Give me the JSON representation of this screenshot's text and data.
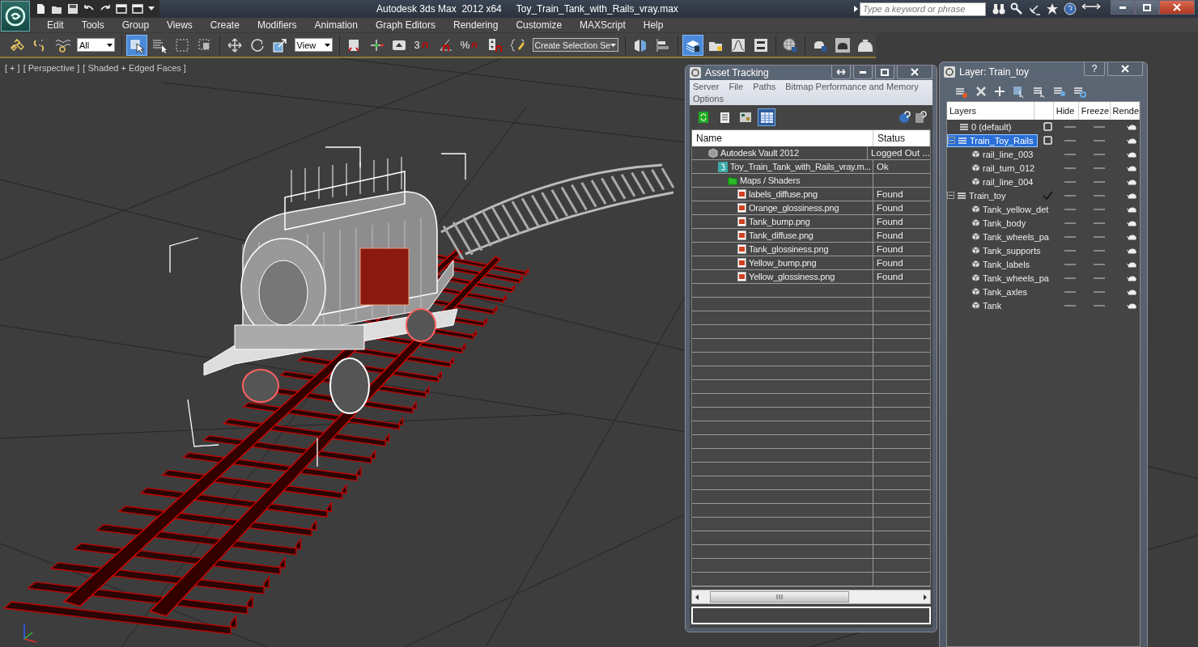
{
  "app": {
    "title": "Autodesk 3ds Max  2012 x64",
    "file": "Toy_Train_Tank_with_Rails_vray.max",
    "search_placeholder": "Type a keyword or phrase"
  },
  "menu": [
    "Edit",
    "Tools",
    "Group",
    "Views",
    "Create",
    "Modifiers",
    "Animation",
    "Graph Editors",
    "Rendering",
    "Customize",
    "MAXScript",
    "Help"
  ],
  "toolbar": [
    {
      "kind": "link",
      "selected": false
    },
    {
      "kind": "unlink",
      "selected": false
    },
    {
      "kind": "bind",
      "selected": false
    },
    {
      "kind": "dropdown",
      "value": "All"
    },
    {
      "kind": "select",
      "selected": true
    },
    {
      "kind": "select-by-name",
      "selected": false
    },
    {
      "kind": "region",
      "selected": false
    },
    {
      "kind": "crossing",
      "selected": false
    },
    {
      "kind": "move",
      "selected": false
    },
    {
      "kind": "rotate",
      "selected": false
    },
    {
      "kind": "scale",
      "selected": false
    },
    {
      "kind": "dropdown",
      "value": "View"
    },
    {
      "kind": "pivot",
      "selected": false
    },
    {
      "kind": "manipulate",
      "selected": false
    },
    {
      "kind": "shortcut",
      "selected": false
    },
    {
      "kind": "snap",
      "label": "3",
      "selected": false
    },
    {
      "kind": "angle-snap",
      "selected": false
    },
    {
      "kind": "snap",
      "label": "%",
      "selected": false
    },
    {
      "kind": "spinner-snap",
      "selected": false
    },
    {
      "kind": "named-sets",
      "selected": false
    },
    {
      "kind": "dropdown",
      "value": "Create Selection Se"
    },
    {
      "kind": "mirror",
      "selected": false
    },
    {
      "kind": "align",
      "selected": false
    },
    {
      "kind": "layers",
      "selected": true
    },
    {
      "kind": "explorer",
      "selected": false
    },
    {
      "kind": "curve",
      "selected": false
    },
    {
      "kind": "schematic",
      "selected": false
    },
    {
      "kind": "material",
      "selected": false
    },
    {
      "kind": "render-setup",
      "selected": false
    },
    {
      "kind": "render-frame",
      "selected": false
    },
    {
      "kind": "render",
      "selected": false
    }
  ],
  "viewport": {
    "labels": [
      "[ + ]",
      "[ Perspective ]",
      "[ Shaded + Edged Faces ]"
    ]
  },
  "asset_tracking": {
    "title": "Asset Tracking",
    "menu": [
      "Server",
      "File",
      "Paths",
      "Bitmap Performance and Memory",
      "Options"
    ],
    "tools": [
      {
        "kind": "refresh",
        "selected": false
      },
      {
        "kind": "list",
        "selected": false
      },
      {
        "kind": "thumbnail",
        "selected": false
      },
      {
        "kind": "table",
        "selected": true
      }
    ],
    "columns": [
      "Name",
      "Status"
    ],
    "rows": [
      {
        "kind": "vault",
        "name": "Autodesk Vault 2012",
        "status": "Logged Out ...",
        "children": [
          {
            "kind": "max-file",
            "name": "Toy_Train_Tank_with_Rails_vray.m...",
            "status": "Ok",
            "children": [
              {
                "kind": "folder",
                "name": "Maps / Shaders",
                "children": [
                  {
                    "kind": "bitmap",
                    "name": "labels_diffuse.png",
                    "status": "Found"
                  },
                  {
                    "kind": "bitmap",
                    "name": "Orange_glossiness.png",
                    "status": "Found"
                  },
                  {
                    "kind": "bitmap",
                    "name": "Tank_bump.png",
                    "status": "Found"
                  },
                  {
                    "kind": "bitmap",
                    "name": "Tank_diffuse.png",
                    "status": "Found"
                  },
                  {
                    "kind": "bitmap",
                    "name": "Tank_glossiness.png",
                    "status": "Found"
                  },
                  {
                    "kind": "bitmap",
                    "name": "Yellow_bump.png",
                    "status": "Found"
                  },
                  {
                    "kind": "bitmap",
                    "name": "Yellow_glossiness.png",
                    "status": "Found"
                  }
                ]
              }
            ]
          }
        ]
      }
    ]
  },
  "layer_window": {
    "title": "Layer: Train_toy",
    "help": "?",
    "columns": [
      "Layers",
      "Hide",
      "Freeze",
      "Rende"
    ],
    "layers": [
      {
        "name": "0 (default)",
        "current": false,
        "selected": false
      },
      {
        "name": "Train_Toy_Rails",
        "current": false,
        "selected": true,
        "expanded": true,
        "children": [
          {
            "name": "rail_line_003"
          },
          {
            "name": "rail_turn_012"
          },
          {
            "name": "rail_line_004"
          }
        ]
      },
      {
        "name": "Train_toy",
        "current": true,
        "selected": false,
        "expanded": true,
        "children": [
          {
            "name": "Tank_yellow_det"
          },
          {
            "name": "Tank_body"
          },
          {
            "name": "Tank_wheels_pa"
          },
          {
            "name": "Tank_supports"
          },
          {
            "name": "Tank_labels"
          },
          {
            "name": "Tank_wheels_pa"
          },
          {
            "name": "Tank_axles"
          },
          {
            "name": "Tank"
          }
        ]
      }
    ]
  }
}
